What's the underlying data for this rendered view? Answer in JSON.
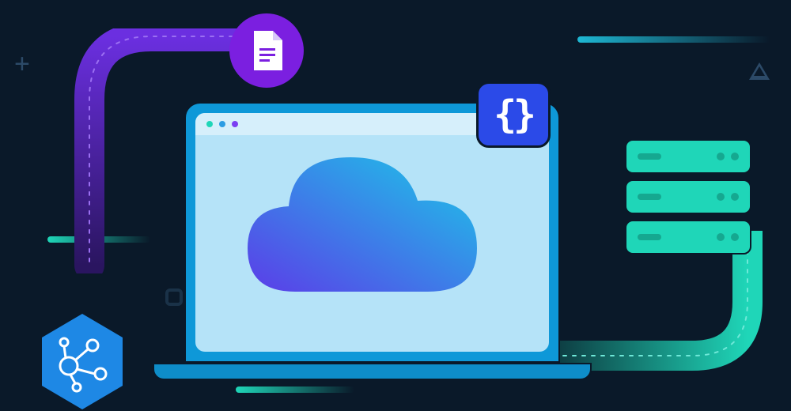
{
  "illustration": {
    "theme": "cloud-computing",
    "background_color": "#0a1929",
    "elements": {
      "document_badge": {
        "color": "#7b1fe0",
        "icon": "document"
      },
      "code_card": {
        "color": "#2b4ae8",
        "symbol": "{}"
      },
      "laptop": {
        "screen_color": "#0e98d8",
        "window_color": "#b5e3f8",
        "dots": [
          "#1fd6b8",
          "#2b9ce3",
          "#7b3ff2"
        ]
      },
      "cloud": {
        "gradient": [
          "#5b3de8",
          "#1bc8e8"
        ]
      },
      "server_stack": {
        "color": "#1fd6b8",
        "rows": 3
      },
      "network_hex": {
        "color": "#1e88e5"
      },
      "connectors": {
        "purple_curve": "#5b2ed0",
        "teal_curve": "#1fd6b8"
      },
      "decorations": [
        "plus",
        "triangle",
        "square",
        "lines"
      ]
    }
  }
}
